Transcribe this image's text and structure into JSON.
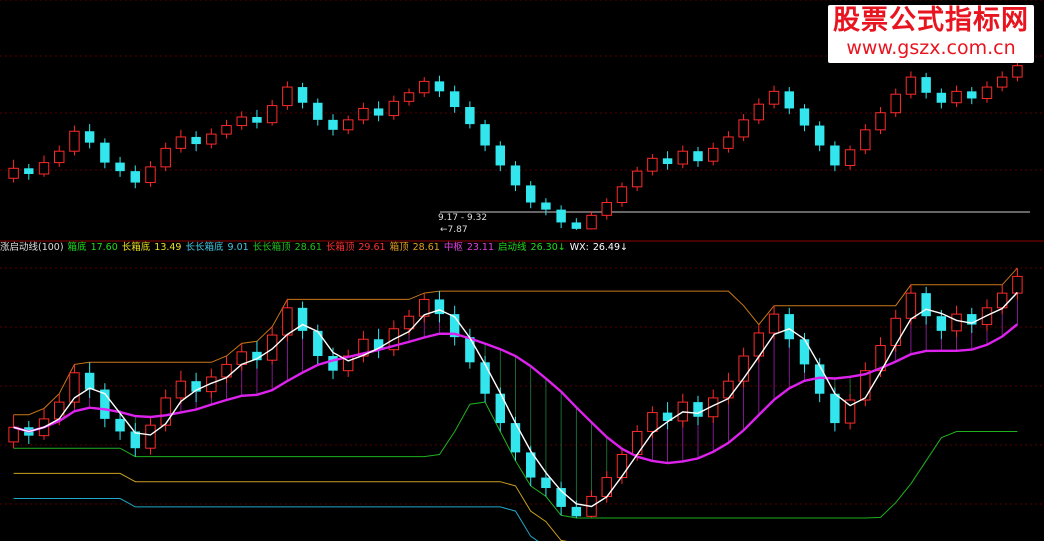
{
  "watermark": {
    "line1": "股票公式指标网",
    "line2": "www.gszx.com.cn"
  },
  "annotations": {
    "range": "9.17 - 9.32",
    "low": "7.87"
  },
  "legend": [
    {
      "key": "name",
      "text": "涨启动线(100)",
      "color": "#dddddd"
    },
    {
      "key": "xd_label",
      "text": "箱底",
      "color": "#20dd20"
    },
    {
      "key": "xd_value",
      "text": "17.60",
      "color": "#20dd20"
    },
    {
      "key": "cxd_label",
      "text": "长箱底",
      "color": "#e8e020"
    },
    {
      "key": "cxd_value",
      "text": "13.49",
      "color": "#e8e020"
    },
    {
      "key": "ccxd_label",
      "text": "长长箱底",
      "color": "#40c8e0"
    },
    {
      "key": "ccxd_value",
      "text": "9.01",
      "color": "#40c8e0"
    },
    {
      "key": "ccxding_label",
      "text": "长长箱顶",
      "color": "#20c020"
    },
    {
      "key": "ccxding_value",
      "text": "28.61",
      "color": "#20c020"
    },
    {
      "key": "cxding_label",
      "text": "长箱顶",
      "color": "#ff3030"
    },
    {
      "key": "cxding_value",
      "text": "29.61",
      "color": "#ff3030"
    },
    {
      "key": "xding_label",
      "text": "箱顶",
      "color": "#e0a020"
    },
    {
      "key": "xding_value",
      "text": "28.61",
      "color": "#e0a020"
    },
    {
      "key": "zq_label",
      "text": "中枢",
      "color": "#e040e0"
    },
    {
      "key": "zq_value",
      "text": "23.11",
      "color": "#e040e0"
    },
    {
      "key": "qd_label",
      "text": "启动线",
      "color": "#20dd20"
    },
    {
      "key": "qd_value",
      "text": "26.30↓",
      "color": "#20dd20"
    },
    {
      "key": "wx_label",
      "text": "WX:",
      "color": "#ffffff"
    },
    {
      "key": "wx_value",
      "text": "26.49↓",
      "color": "#ffffff"
    }
  ],
  "colors": {
    "up": "#ff2a2a",
    "down": "#33e6ee",
    "ma": "#ffffff",
    "center": "#dd22ee",
    "start": "#22cc22"
  },
  "chart_data": {
    "type": "candlestick",
    "note": "Two-pane stock chart; values read approximately from the chart (no price axis is printed). Candles are listed chronologically.",
    "candles": [
      [
        11.5,
        12.2,
        12.8,
        11.2
      ],
      [
        12.2,
        11.8,
        12.5,
        11.4
      ],
      [
        11.8,
        12.6,
        13.1,
        11.6
      ],
      [
        12.6,
        13.4,
        13.8,
        12.3
      ],
      [
        13.4,
        14.8,
        15.2,
        13.1
      ],
      [
        14.8,
        14.0,
        15.3,
        13.6
      ],
      [
        14.0,
        12.6,
        14.3,
        12.2
      ],
      [
        12.6,
        12.0,
        13.0,
        11.6
      ],
      [
        12.0,
        11.2,
        12.4,
        10.8
      ],
      [
        11.2,
        12.3,
        12.7,
        10.9
      ],
      [
        12.3,
        13.6,
        14.0,
        12.0
      ],
      [
        13.6,
        14.4,
        14.9,
        13.3
      ],
      [
        14.4,
        13.9,
        14.8,
        13.4
      ],
      [
        13.9,
        14.6,
        15.0,
        13.6
      ],
      [
        14.6,
        15.2,
        15.6,
        14.3
      ],
      [
        15.2,
        15.8,
        16.2,
        14.9
      ],
      [
        15.8,
        15.4,
        16.3,
        15.0
      ],
      [
        15.4,
        16.6,
        17.0,
        15.2
      ],
      [
        16.6,
        17.9,
        18.3,
        16.3
      ],
      [
        17.9,
        16.8,
        18.2,
        16.4
      ],
      [
        16.8,
        15.6,
        17.1,
        15.2
      ],
      [
        15.6,
        14.9,
        16.0,
        14.5
      ],
      [
        14.9,
        15.6,
        15.9,
        14.6
      ],
      [
        15.6,
        16.4,
        16.8,
        15.3
      ],
      [
        16.4,
        15.9,
        16.9,
        15.5
      ],
      [
        15.9,
        16.9,
        17.3,
        15.6
      ],
      [
        16.9,
        17.5,
        17.8,
        16.6
      ],
      [
        17.5,
        18.3,
        18.6,
        17.2
      ],
      [
        18.3,
        17.6,
        18.7,
        17.2
      ],
      [
        17.6,
        16.5,
        18.0,
        16.1
      ],
      [
        16.5,
        15.3,
        16.9,
        15.0
      ],
      [
        15.3,
        13.8,
        15.6,
        13.4
      ],
      [
        13.8,
        12.4,
        14.1,
        12.0
      ],
      [
        12.4,
        11.0,
        12.7,
        10.6
      ],
      [
        11.0,
        9.8,
        11.3,
        9.4
      ],
      [
        9.8,
        9.3,
        10.1,
        8.9
      ],
      [
        9.3,
        8.4,
        9.6,
        8.0
      ],
      [
        8.4,
        7.95,
        8.7,
        7.87
      ],
      [
        7.95,
        8.9,
        9.2,
        7.9
      ],
      [
        8.9,
        9.8,
        10.1,
        8.6
      ],
      [
        9.8,
        10.9,
        11.2,
        9.5
      ],
      [
        10.9,
        12.0,
        12.3,
        10.6
      ],
      [
        12.0,
        12.9,
        13.2,
        11.7
      ],
      [
        12.9,
        12.5,
        13.4,
        12.1
      ],
      [
        12.5,
        13.4,
        13.8,
        12.2
      ],
      [
        13.4,
        12.7,
        13.7,
        12.3
      ],
      [
        12.7,
        13.6,
        14.0,
        12.4
      ],
      [
        13.6,
        14.4,
        14.8,
        13.3
      ],
      [
        14.4,
        15.6,
        16.0,
        14.1
      ],
      [
        15.6,
        16.7,
        17.1,
        15.3
      ],
      [
        16.7,
        17.6,
        18.0,
        16.4
      ],
      [
        17.6,
        16.4,
        17.9,
        16.0
      ],
      [
        16.4,
        15.2,
        16.7,
        14.8
      ],
      [
        15.2,
        13.8,
        15.5,
        13.4
      ],
      [
        13.8,
        12.4,
        14.1,
        12.0
      ],
      [
        12.4,
        13.5,
        13.8,
        12.1
      ],
      [
        13.5,
        14.9,
        15.3,
        13.2
      ],
      [
        14.9,
        16.1,
        16.5,
        14.6
      ],
      [
        16.1,
        17.4,
        17.8,
        15.8
      ],
      [
        17.4,
        18.6,
        19.0,
        17.1
      ],
      [
        18.6,
        17.5,
        18.9,
        17.1
      ],
      [
        17.5,
        16.8,
        17.8,
        16.4
      ],
      [
        16.8,
        17.6,
        18.0,
        16.5
      ],
      [
        17.6,
        17.1,
        17.9,
        16.7
      ],
      [
        17.1,
        17.9,
        18.3,
        16.8
      ],
      [
        17.9,
        18.6,
        19.0,
        17.6
      ],
      [
        18.6,
        19.4,
        19.8,
        18.3
      ]
    ],
    "moving_average": "white line tracking close",
    "center_line": "magenta 中枢 line",
    "box_levels": "箱底 / 长箱底 / 长长箱底 / 箱顶 / 长箱顶 / 长长箱顶 step lines"
  }
}
